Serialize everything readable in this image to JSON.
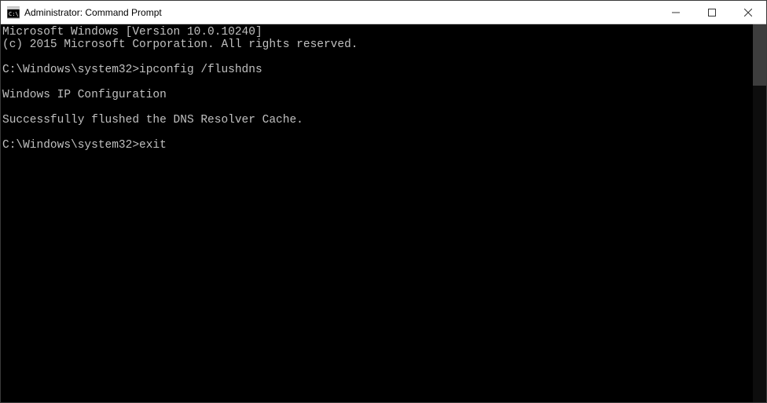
{
  "window": {
    "title": "Administrator: Command Prompt"
  },
  "terminal": {
    "lines": [
      "Microsoft Windows [Version 10.0.10240]",
      "(c) 2015 Microsoft Corporation. All rights reserved.",
      "",
      "C:\\Windows\\system32>ipconfig /flushdns",
      "",
      "Windows IP Configuration",
      "",
      "Successfully flushed the DNS Resolver Cache.",
      "",
      "C:\\Windows\\system32>exit"
    ]
  }
}
